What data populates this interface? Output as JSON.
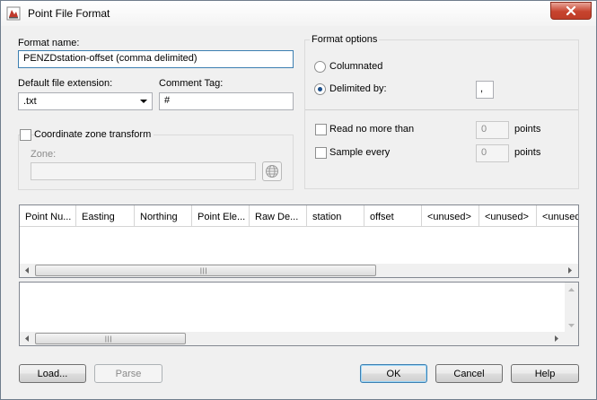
{
  "window": {
    "title": "Point File Format"
  },
  "format_name": {
    "label": "Format name:",
    "value": "PENZDstation-offset (comma delimited)"
  },
  "default_ext": {
    "label": "Default file extension:",
    "value": ".txt"
  },
  "comment_tag": {
    "label": "Comment Tag:",
    "value": "#"
  },
  "coord_zone": {
    "label": "Coordinate zone transform",
    "checked": false,
    "zone_label": "Zone:",
    "zone_value": ""
  },
  "format_options": {
    "legend": "Format options",
    "columnated_label": "Columnated",
    "delimited_label": "Delimited by:",
    "selected": "delimited",
    "delimiter_value": ",",
    "read_no_more_label": "Read no more than",
    "read_no_more_value": "0",
    "read_no_more_unit": "points",
    "sample_every_label": "Sample every",
    "sample_every_value": "0",
    "sample_every_unit": "points"
  },
  "columns": {
    "headers": [
      "Point Nu...",
      "Easting",
      "Northing",
      "Point Ele...",
      "Raw De...",
      "station",
      "offset",
      "<unused>",
      "<unused>",
      "<unused"
    ]
  },
  "buttons": {
    "load": "Load...",
    "parse": "Parse",
    "ok": "OK",
    "cancel": "Cancel",
    "help": "Help"
  },
  "scroll": {
    "grip": "|||"
  },
  "icons": {
    "app": "civil3d-app-icon",
    "close": "close-icon",
    "globe": "globe-icon"
  },
  "colors": {
    "close_red": "#c7432e",
    "focus_blue": "#3c7fb1",
    "radio_dot": "#1c4f8a"
  }
}
